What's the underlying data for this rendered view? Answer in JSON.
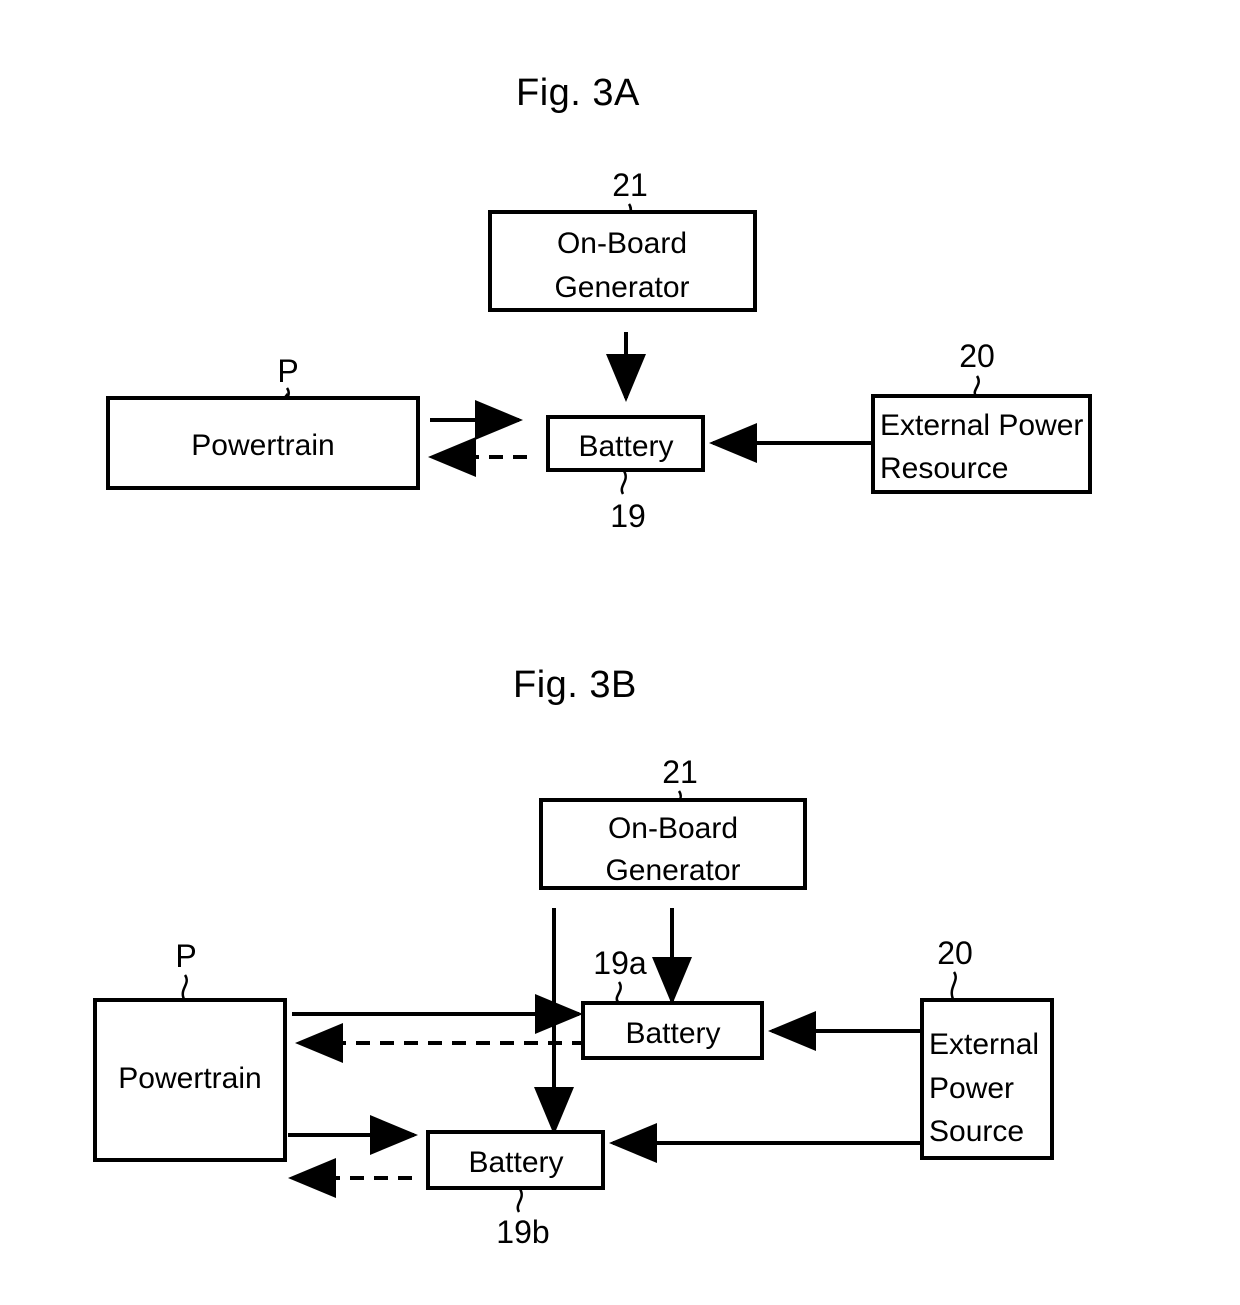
{
  "figures": [
    {
      "id": "fig-3a",
      "title": "Fig. 3A",
      "nodes": {
        "generator": {
          "label_line1": "On-Board",
          "label_line2": "Generator",
          "ref": "21"
        },
        "powertrain": {
          "label": "Powertrain",
          "ref": "P"
        },
        "battery": {
          "label": "Battery",
          "ref": "19"
        },
        "external": {
          "label_line1": "External Power",
          "label_line2": "Resource",
          "ref": "20"
        }
      }
    },
    {
      "id": "fig-3b",
      "title": "Fig. 3B",
      "nodes": {
        "generator": {
          "label_line1": "On-Board",
          "label_line2": "Generator",
          "ref": "21"
        },
        "powertrain": {
          "label": "Powertrain",
          "ref": "P"
        },
        "battery_a": {
          "label": "Battery",
          "ref": "19a"
        },
        "battery_b": {
          "label": "Battery",
          "ref": "19b"
        },
        "external": {
          "label_line1": "External",
          "label_line2": "Power",
          "label_line3": "Source",
          "ref": "20"
        }
      }
    }
  ],
  "colors": {
    "ink": "#000000",
    "paper": "#ffffff"
  }
}
